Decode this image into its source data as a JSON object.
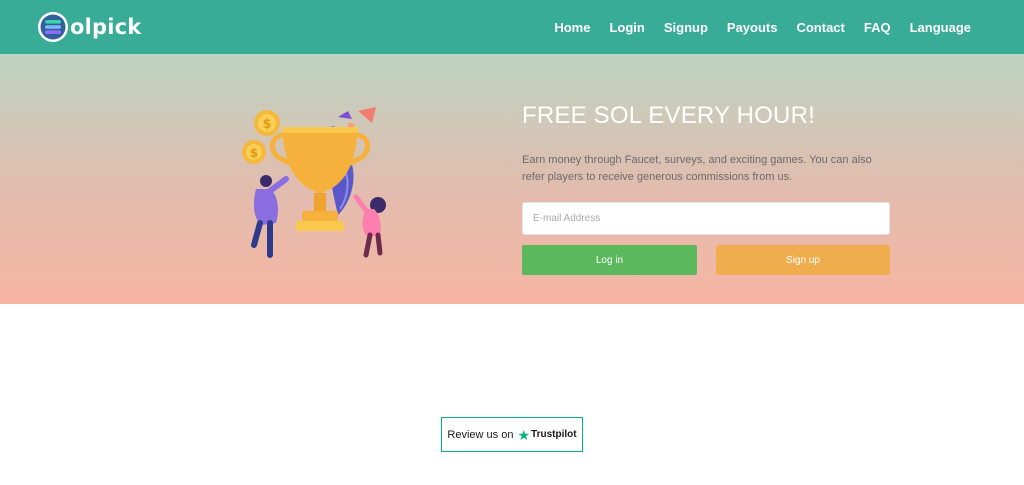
{
  "brand": {
    "logo_text": "olpick",
    "logo_icon": "solpick-s-icon"
  },
  "nav": {
    "items": [
      {
        "label": "Home"
      },
      {
        "label": "Login"
      },
      {
        "label": "Signup"
      },
      {
        "label": "Payouts"
      },
      {
        "label": "Contact"
      },
      {
        "label": "FAQ"
      },
      {
        "label": "Language"
      }
    ]
  },
  "hero": {
    "title": "FREE SOL EVERY HOUR!",
    "description": "Earn money through Faucet, surveys, and exciting games. You can also refer players to receive generous commissions from us.",
    "email_placeholder": "E-mail Address",
    "email_value": "",
    "login_label": "Log in",
    "signup_label": "Sign up",
    "illustration": "trophy-celebration-illustration"
  },
  "trustpilot": {
    "review_text": "Review us on",
    "brand": "Trustpilot",
    "icon": "trustpilot-star-icon"
  },
  "colors": {
    "nav_bg": "#38ac97",
    "login_btn": "#5cb85c",
    "signup_btn": "#f0ad4e",
    "trustpilot_green": "#00b67a"
  }
}
